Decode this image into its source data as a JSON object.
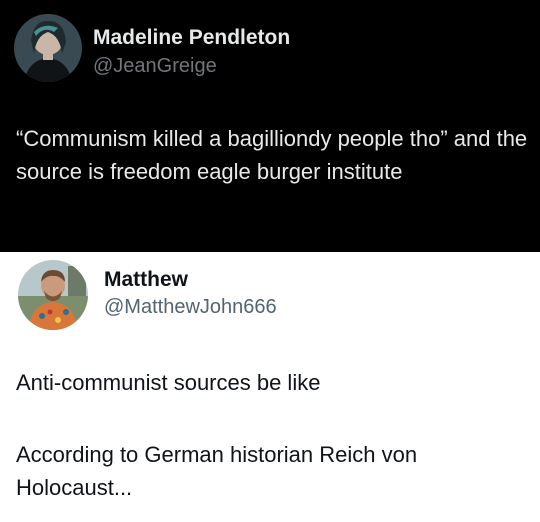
{
  "tweets": [
    {
      "display_name": "Madeline Pendleton",
      "handle": "@JeanGreige",
      "avatar_icon": "profile-photo-avatar",
      "text": "“Communism killed a bagilliondy people tho” and the source is freedom eagle burger institute",
      "theme": "dark"
    },
    {
      "display_name": "Matthew",
      "handle": "@MatthewJohn666",
      "avatar_icon": "profile-photo-avatar",
      "paragraphs": [
        "Anti-communist sources be like",
        "According to German historian Reich von Holocaust..."
      ],
      "theme": "light"
    }
  ],
  "colors": {
    "dark_bg": "#000000",
    "dark_text": "#e7e9ea",
    "dark_handle": "#71767b",
    "light_bg": "#ffffff",
    "light_text": "#0f1419",
    "light_handle": "#536471"
  }
}
